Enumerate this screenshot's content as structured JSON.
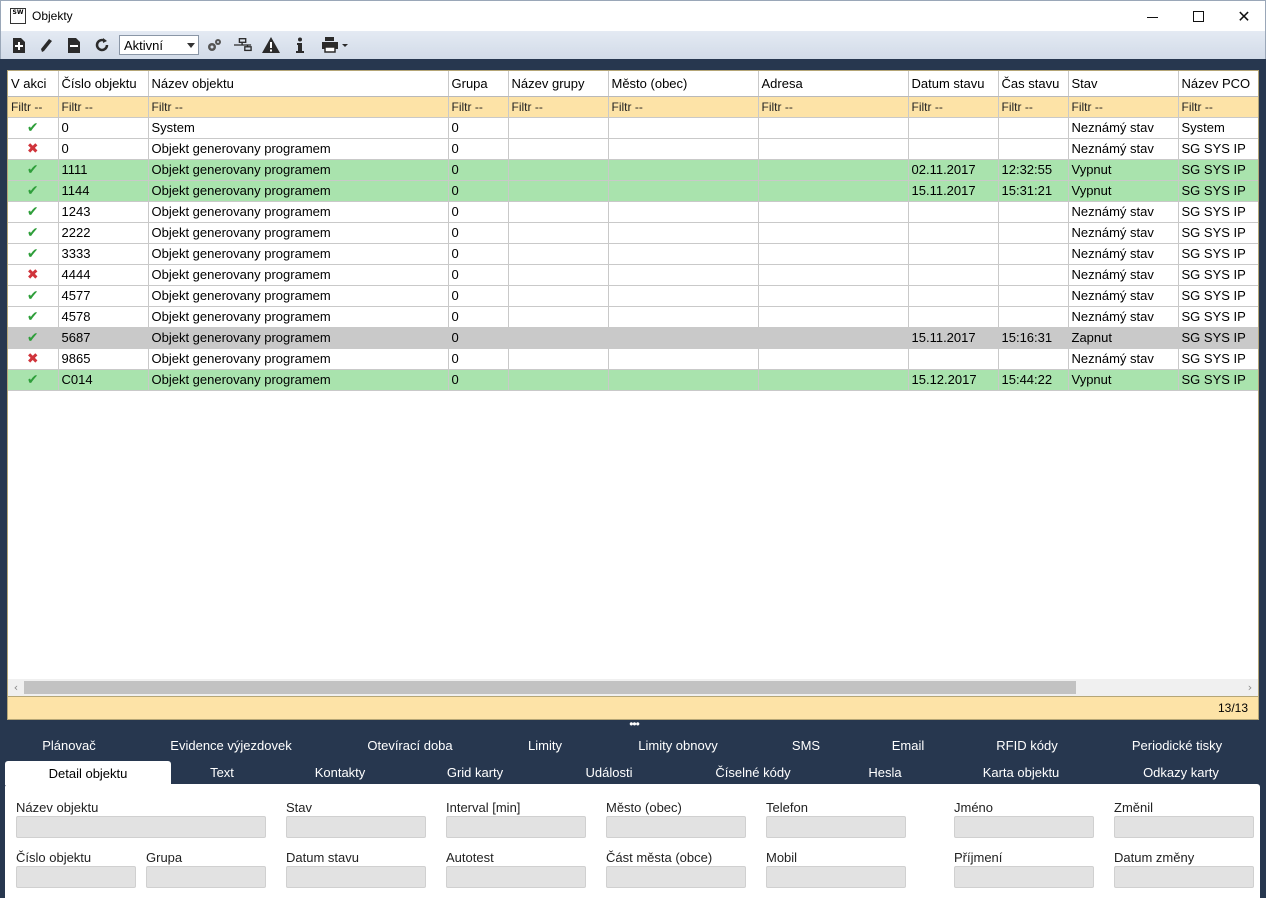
{
  "window": {
    "title": "Objekty",
    "logo_text": "SW",
    "controls": [
      "minimize-icon",
      "maximize-icon",
      "close-icon"
    ]
  },
  "toolbar": {
    "icons": [
      "add-icon",
      "edit-icon",
      "delete-icon",
      "refresh-icon",
      "settings-icon",
      "tree-icon",
      "warning-icon",
      "info-icon",
      "print-icon"
    ],
    "filter_select_value": "Aktivní"
  },
  "grid": {
    "columns": [
      "V akci",
      "Číslo objektu",
      "Název objektu",
      "Grupa",
      "Název grupy",
      "Město (obec)",
      "Adresa",
      "Datum stavu",
      "Čas stavu",
      "Stav",
      "Název PCO"
    ],
    "filter_placeholder": "Filtr --",
    "rows": [
      {
        "active": "check",
        "number": "0",
        "name": "System",
        "group": "0",
        "group_name": "",
        "city": "",
        "address": "",
        "date": "",
        "time": "",
        "state": "Neznámý stav",
        "pco": "System",
        "style": "normal"
      },
      {
        "active": "cross",
        "number": "0",
        "name": "Objekt generovany programem",
        "group": "0",
        "group_name": "",
        "city": "",
        "address": "",
        "date": "",
        "time": "",
        "state": "Neznámý stav",
        "pco": "SG SYS IP",
        "style": "normal"
      },
      {
        "active": "check",
        "number": "1111",
        "name": "Objekt generovany programem",
        "group": "0",
        "group_name": "",
        "city": "",
        "address": "",
        "date": "02.11.2017",
        "time": "12:32:55",
        "state": "Vypnut",
        "pco": "SG SYS IP",
        "style": "green"
      },
      {
        "active": "check",
        "number": "1144",
        "name": "Objekt generovany programem",
        "group": "0",
        "group_name": "",
        "city": "",
        "address": "",
        "date": "15.11.2017",
        "time": "15:31:21",
        "state": "Vypnut",
        "pco": "SG SYS IP",
        "style": "green"
      },
      {
        "active": "check",
        "number": "1243",
        "name": "Objekt generovany programem",
        "group": "0",
        "group_name": "",
        "city": "",
        "address": "",
        "date": "",
        "time": "",
        "state": "Neznámý stav",
        "pco": "SG SYS IP",
        "style": "normal"
      },
      {
        "active": "check",
        "number": "2222",
        "name": "Objekt generovany programem",
        "group": "0",
        "group_name": "",
        "city": "",
        "address": "",
        "date": "",
        "time": "",
        "state": "Neznámý stav",
        "pco": "SG SYS IP",
        "style": "normal"
      },
      {
        "active": "check",
        "number": "3333",
        "name": "Objekt generovany programem",
        "group": "0",
        "group_name": "",
        "city": "",
        "address": "",
        "date": "",
        "time": "",
        "state": "Neznámý stav",
        "pco": "SG SYS IP",
        "style": "normal"
      },
      {
        "active": "cross",
        "number": "4444",
        "name": "Objekt generovany programem",
        "group": "0",
        "group_name": "",
        "city": "",
        "address": "",
        "date": "",
        "time": "",
        "state": "Neznámý stav",
        "pco": "SG SYS IP",
        "style": "normal"
      },
      {
        "active": "check",
        "number": "4577",
        "name": "Objekt generovany programem",
        "group": "0",
        "group_name": "",
        "city": "",
        "address": "",
        "date": "",
        "time": "",
        "state": "Neznámý stav",
        "pco": "SG SYS IP",
        "style": "normal"
      },
      {
        "active": "check",
        "number": "4578",
        "name": "Objekt generovany programem",
        "group": "0",
        "group_name": "",
        "city": "",
        "address": "",
        "date": "",
        "time": "",
        "state": "Neznámý stav",
        "pco": "SG SYS IP",
        "style": "normal"
      },
      {
        "active": "check",
        "number": "5687",
        "name": "Objekt generovany programem",
        "group": "0",
        "group_name": "",
        "city": "",
        "address": "",
        "date": "15.11.2017",
        "time": "15:16:31",
        "state": "Zapnut",
        "pco": "SG SYS IP",
        "style": "gray"
      },
      {
        "active": "cross",
        "number": "9865",
        "name": "Objekt generovany programem",
        "group": "0",
        "group_name": "",
        "city": "",
        "address": "",
        "date": "",
        "time": "",
        "state": "Neznámý stav",
        "pco": "SG SYS IP",
        "style": "normal"
      },
      {
        "active": "check",
        "number": "C014",
        "name": "Objekt generovany programem",
        "group": "0",
        "group_name": "",
        "city": "",
        "address": "",
        "date": "15.12.2017",
        "time": "15:44:22",
        "state": "Vypnut",
        "pco": "SG SYS IP",
        "style": "green"
      }
    ],
    "record_count": "13/13",
    "colors": {
      "filter_bg": "#fde3a7",
      "green_row": "#a9e3ad",
      "gray_row": "#c9c9c9",
      "check": "#2e9e3a",
      "cross": "#d0343b",
      "frame": "#27374f"
    }
  },
  "tabs": {
    "row1": [
      "Plánovač",
      "Evidence výjezdovek",
      "Otevírací doba",
      "Limity",
      "Limity obnovy",
      "SMS",
      "Email",
      "RFID kódy",
      "Periodické tisky"
    ],
    "row2": [
      "Detail objektu",
      "Text",
      "Kontakty",
      "Grid karty",
      "Události",
      "Číselné kódy",
      "Hesla",
      "Karta objektu",
      "Odkazy karty"
    ],
    "active": "Detail objektu"
  },
  "detail": {
    "labels": {
      "name": "Název objektu",
      "state": "Stav",
      "interval": "Interval [min]",
      "city": "Město (obec)",
      "phone": "Telefon",
      "first_name": "Jméno",
      "changed_by": "Změnil",
      "number": "Číslo objektu",
      "group": "Grupa",
      "state_date": "Datum stavu",
      "autotest": "Autotest",
      "district": "Část města (obce)",
      "mobile": "Mobil",
      "surname": "Příjmení",
      "change_date": "Datum změny"
    }
  }
}
